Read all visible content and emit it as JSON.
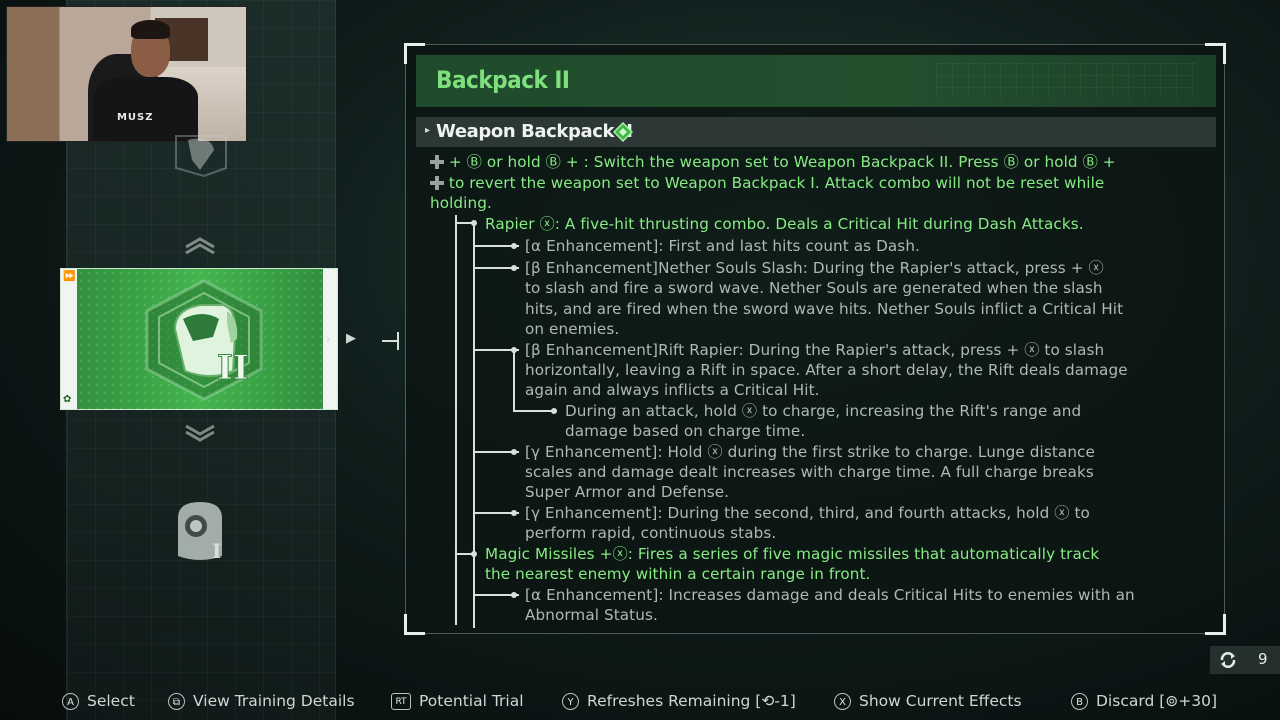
{
  "panel": {
    "title": "Backpack II",
    "subtitle": "Weapon Backpack II",
    "lines": [
      {
        "text": " + Ⓑ or hold Ⓑ + : Switch the weapon set to Weapon Backpack II. Press Ⓑ or hold Ⓑ +",
        "color": "#86ec82"
      },
      {
        "text": " to revert the weapon set to Weapon Backpack I. Attack combo will not be reset while",
        "color": "#86ec82"
      },
      {
        "text": "holding.",
        "color": "#86ec82"
      },
      {
        "text": "Rapier ⓧ: A five-hit thrusting combo. Deals a Critical Hit during Dash Attacks.",
        "color": "#86ec82"
      },
      {
        "text": "[α Enhancement]: First and last hits count as Dash.",
        "color": "#aeb8b4"
      },
      {
        "text": "[β Enhancement]Nether Souls Slash: During the Rapier's attack, press  + ⓧ",
        "color": "#aeb8b4"
      },
      {
        "text": "to slash and fire a sword wave. Nether Souls are generated when the slash",
        "color": "#aeb8b4"
      },
      {
        "text": "hits, and are fired when the sword wave hits. Nether Souls inflict a Critical Hit",
        "color": "#aeb8b4"
      },
      {
        "text": "on enemies.",
        "color": "#aeb8b4"
      },
      {
        "text": "[β Enhancement]Rift Rapier: During the Rapier's attack, press  + ⓧ to slash",
        "color": "#aeb8b4"
      },
      {
        "text": "horizontally, leaving a Rift in space. After a short delay, the Rift deals damage",
        "color": "#aeb8b4"
      },
      {
        "text": "again and always inflicts a Critical Hit.",
        "color": "#aeb8b4"
      },
      {
        "text": "During an attack, hold ⓧ to charge, increasing the Rift's range and",
        "color": "#aeb8b4"
      },
      {
        "text": "damage based on charge time.",
        "color": "#aeb8b4"
      },
      {
        "text": "[γ Enhancement]: Hold ⓧ during the first strike to charge. Lunge distance",
        "color": "#aeb8b4"
      },
      {
        "text": "scales and damage dealt increases with charge time. A full charge breaks",
        "color": "#aeb8b4"
      },
      {
        "text": "Super Armor and Defense.",
        "color": "#aeb8b4"
      },
      {
        "text": "[γ Enhancement]: During the second, third, and fourth attacks, hold ⓧ to",
        "color": "#aeb8b4"
      },
      {
        "text": "perform rapid, continuous stabs.",
        "color": "#aeb8b4"
      },
      {
        "text": "Magic Missiles +ⓧ: Fires a series of five magic missiles that automatically track",
        "color": "#86ec82"
      },
      {
        "text": "the nearest enemy within a certain range in front.",
        "color": "#86ec82"
      },
      {
        "text": "[α Enhancement]: Increases damage and deals Critical Hits to enemies with an",
        "color": "#aeb8b4"
      },
      {
        "text": "Abnormal Status.",
        "color": "#aeb8b4"
      }
    ]
  },
  "left": {
    "selected_card": "Backpack II",
    "card_numeral": "II",
    "bottom_numeral": "I"
  },
  "refresh": {
    "count": "9"
  },
  "footer": {
    "select": {
      "key": "A",
      "label": "Select"
    },
    "training": {
      "key": "⧉",
      "label": "View Training Details"
    },
    "potential": {
      "key": "RT",
      "label": "Potential Trial"
    },
    "refreshes": {
      "key": "Y",
      "label": "Refreshes Remaining [⟲-1]"
    },
    "effects": {
      "key": "X",
      "label": "Show Current Effects"
    },
    "discard": {
      "key": "B",
      "label": "Discard [⊚+30]"
    }
  },
  "colors": {
    "accent_green": "#86ec82",
    "card_green": "#45b550",
    "body_text": "#aeb8b4"
  }
}
